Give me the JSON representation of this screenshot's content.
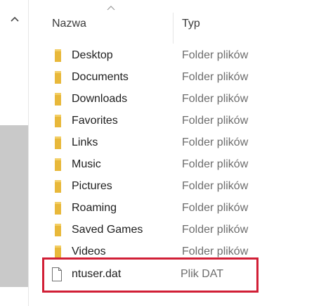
{
  "columns": {
    "name": "Nazwa",
    "type": "Typ"
  },
  "folders": [
    {
      "name": "Desktop",
      "type": "Folder plików"
    },
    {
      "name": "Documents",
      "type": "Folder plików"
    },
    {
      "name": "Downloads",
      "type": "Folder plików"
    },
    {
      "name": "Favorites",
      "type": "Folder plików"
    },
    {
      "name": "Links",
      "type": "Folder plików"
    },
    {
      "name": "Music",
      "type": "Folder plików"
    },
    {
      "name": "Pictures",
      "type": "Folder plików"
    },
    {
      "name": "Roaming",
      "type": "Folder plików"
    },
    {
      "name": "Saved Games",
      "type": "Folder plików"
    },
    {
      "name": "Videos",
      "type": "Folder plików"
    }
  ],
  "file": {
    "name": "ntuser.dat",
    "type": "Plik DAT"
  },
  "colors": {
    "folder": "#e8b83a",
    "highlight": "#d11f36"
  }
}
